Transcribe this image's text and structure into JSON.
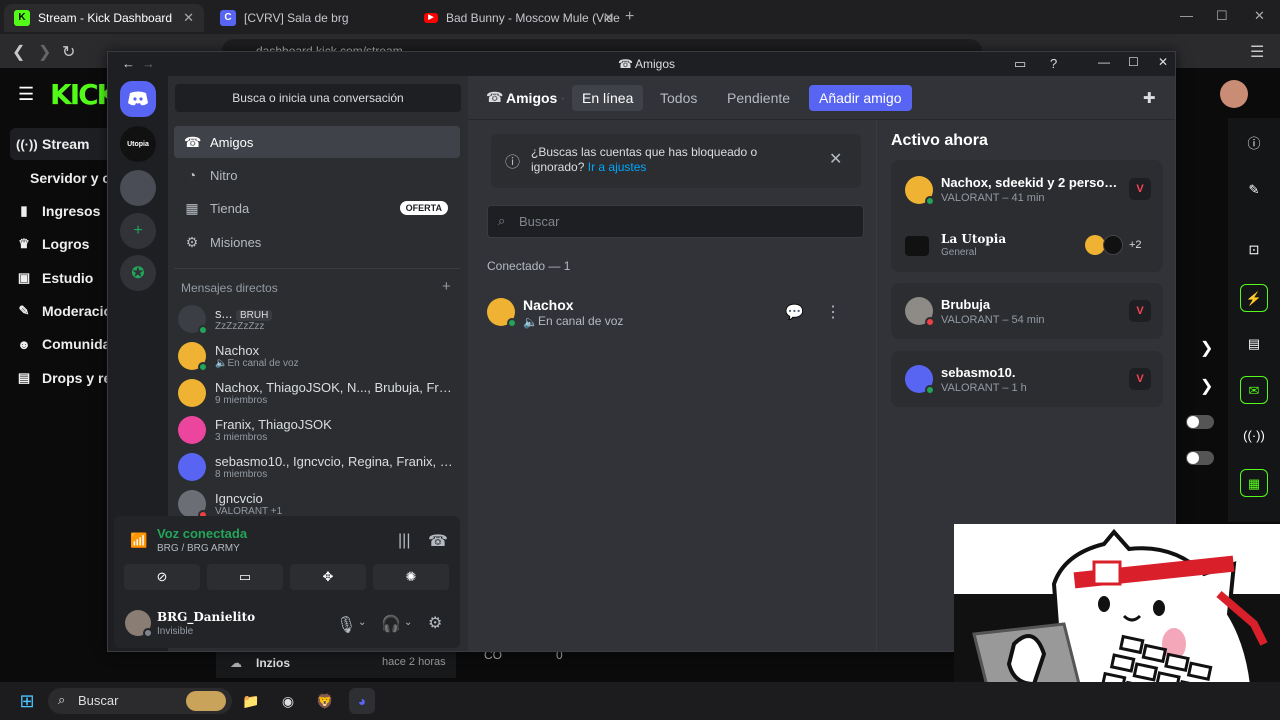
{
  "browser": {
    "tabs": [
      {
        "title": "Stream - Kick Dashboard",
        "active": true
      },
      {
        "title": "[CVRV] Sala de brg",
        "active": false
      },
      {
        "title": "Bad Bunny - Moscow Mule (Vide",
        "active": false
      }
    ],
    "url": "dashboard.kick.com/stream"
  },
  "kick": {
    "logo": "KICK",
    "nav": [
      {
        "label": "Stream",
        "icon": "broadcast-icon"
      },
      {
        "label": "Servidor y c",
        "icon": ""
      },
      {
        "label": "Ingresos",
        "icon": "chart-icon"
      },
      {
        "label": "Logros",
        "icon": "trophy-icon"
      },
      {
        "label": "Estudio",
        "icon": "studio-icon"
      },
      {
        "label": "Moderacio",
        "icon": "wrench-icon"
      },
      {
        "label": "Comunida",
        "icon": "community-icon"
      },
      {
        "label": "Drops y re",
        "icon": "drops-icon"
      }
    ],
    "bottom_item": {
      "label": "Inzios",
      "time": "hace 2 horas"
    },
    "bottom_stats": {
      "followers": "CO",
      "count": "0"
    }
  },
  "discord": {
    "window_title": "Amigos",
    "search_conv": "Busca o inicia una conversación",
    "nav": [
      {
        "label": "Amigos",
        "icon": "friends-icon",
        "selected": true
      },
      {
        "label": "Nitro",
        "icon": "nitro-icon",
        "selected": false
      },
      {
        "label": "Tienda",
        "icon": "shop-icon",
        "selected": false,
        "badge": "OFERTA"
      },
      {
        "label": "Misiones",
        "icon": "quests-icon",
        "selected": false
      }
    ],
    "dm_header": "Mensajes directos",
    "dms": [
      {
        "name": "s...",
        "tag": "BRUH",
        "sub": "ZzZzZzZzz",
        "status": "#23a559",
        "avatar_color": "#3b3f45"
      },
      {
        "name": "Nachox",
        "sub": "En canal de voz",
        "status": "#23a559",
        "avatar_color": "#f0b232"
      },
      {
        "name": "Nachox, ThiagoJSOK, N..., Brubuja, Fra...",
        "sub": "9 miembros",
        "status": "",
        "avatar_color": "#f0b232"
      },
      {
        "name": "Franix, ThiagoJSOK",
        "sub": "3 miembros",
        "status": "",
        "avatar_color": "#eb459e"
      },
      {
        "name": "sebasmo10., Igncvcio, Regina, Franix, Bru...",
        "sub": "8 miembros",
        "status": "",
        "avatar_color": "#5865f2"
      },
      {
        "name": "Igncvcio",
        "sub": "VALORANT +1",
        "status": "#f23f43",
        "avatar_color": "#6b6e75"
      }
    ],
    "voice": {
      "status": "Voz conectada",
      "channel": "BRG / BRG ARMY"
    },
    "user": {
      "name": "BRG_Danielito",
      "status": "Invisible"
    },
    "tabs": {
      "friends": "Amigos",
      "online": "En línea",
      "all": "Todos",
      "pending": "Pendiente",
      "add": "Añadir amigo"
    },
    "info": {
      "text": "¿Buscas las cuentas que has bloqueado o ignorado?",
      "link": "Ir a ajustes"
    },
    "search_placeholder": "Buscar",
    "connected_header": "Conectado — 1",
    "friend": {
      "name": "Nachox",
      "sub": "En canal de voz"
    },
    "active_now": {
      "title": "Activo ahora",
      "cards": [
        {
          "name": "Nachox, sdeekid y 2 persona...",
          "sub": "VALORANT – 41 min",
          "server": "La Utopia",
          "channel": "General",
          "extra": "+2"
        },
        {
          "name": "Brubuja",
          "sub": "VALORANT – 54 min"
        },
        {
          "name": "sebasmo10.",
          "sub": "VALORANT – 1 h"
        }
      ]
    }
  },
  "taskbar": {
    "search": "Buscar"
  }
}
